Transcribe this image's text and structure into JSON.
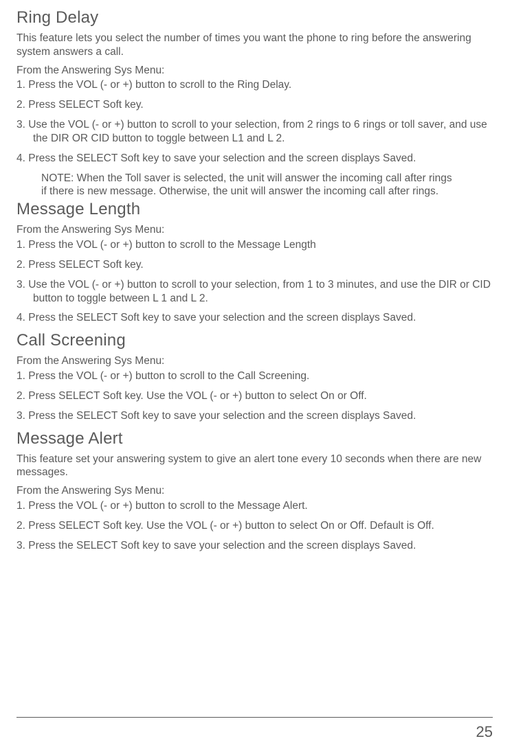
{
  "sections": [
    {
      "title": "Ring Delay",
      "intro": "This feature lets you select the number of times you want the phone to ring before the answering system answers a call.",
      "menu_line": "From the Answering Sys Menu:",
      "steps": [
        "1. Press the VOL (- or +) button to scroll to the Ring Delay.",
        "2. Press SELECT Soft key.",
        "3. Use the  VOL (- or +) button to scroll to your selection, from 2 rings to 6 rings or toll saver, and use the DIR OR CID  button to toggle between L1 and L 2.",
        "4. Press the SELECT Soft key to save your selection and the screen displays Saved."
      ],
      "note": "NOTE: When the Toll saver is selected, the unit will answer the incoming call after  rings if there is new message. Otherwise, the unit will answer the incoming call after  rings."
    },
    {
      "title": "Message Length",
      "intro": "",
      "menu_line": "From the Answering Sys Menu:",
      "steps": [
        "1. Press the VOL (- or +) button to scroll to the Message Length",
        "2. Press SELECT Soft key.",
        "3. Use the  VOL (- or +) button to scroll to your selection, from 1 to 3 minutes, and use the DIR or CID  button to toggle between L 1 and L 2.",
        "4. Press the SELECT Soft key to save your selection and the screen displays Saved."
      ],
      "note": ""
    },
    {
      "title": "Call Screening",
      "intro": "",
      "menu_line": "From the Answering Sys Menu:",
      "steps": [
        "1. Press the VOL (- or +) button to scroll to the Call Screening.",
        "2. Press SELECT  Soft key. Use the VOL (- or +) button to select On or Off.",
        "3. Press the SELECT Soft key to save your selection and the screen displays Saved."
      ],
      "note": ""
    },
    {
      "title": "Message Alert",
      "intro": "This feature set your answering system to give an alert tone every 10 seconds when there are new messages.",
      "menu_line": "From the Answering Sys Menu:",
      "steps": [
        "1. Press the VOL (- or +) button to scroll to the Message Alert.",
        "2. Press SELECT Soft key. Use the VOL (- or +) button to select On or Off. Default is Off.",
        "3. Press the SELECT Soft key to save your selection and the screen displays Saved."
      ],
      "note": ""
    }
  ],
  "page_number": "25"
}
